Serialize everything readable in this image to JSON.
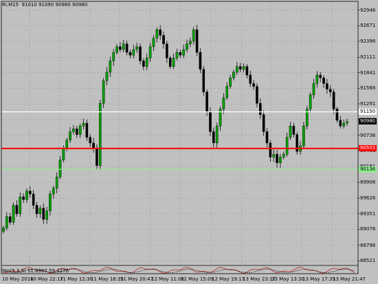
{
  "header": {
    "symbol_line": "RI,M15  91010 91090 90980 90980"
  },
  "price_axis": {
    "labels": [
      "92946",
      "92671",
      "92396",
      "92111",
      "91841",
      "91566",
      "91291",
      "91016",
      "90736",
      "90461",
      "90181",
      "89906",
      "89626",
      "89351",
      "89076",
      "88796",
      "88521"
    ]
  },
  "horizontal_lines": [
    {
      "name": "white-level",
      "label": "91150",
      "price": 91150,
      "color": "#ffffff",
      "text_color": "#000000"
    },
    {
      "name": "red-level",
      "label": "90503",
      "price": 90503,
      "color": "#ff0000",
      "text_color": "#ffffff"
    },
    {
      "name": "green-level",
      "label": "90136",
      "price": 90136,
      "color": "#90ee90",
      "text_color": "#000000"
    }
  ],
  "current_price": {
    "label": "90980",
    "price": 90980
  },
  "indicator": {
    "label": "Sto(5,3,3) 51.8987 59.4276"
  },
  "time_axis": {
    "labels": [
      "10 May 2016",
      "10 May 22:17",
      "11 May 12:30",
      "11 May 16:35",
      "11 May 20:47",
      "12 May 11:00",
      "12 May 15:09",
      "12 May 19:17",
      "13 May 23:17",
      "13 May 13:30",
      "13 May 17:35",
      "13 May 21:47"
    ]
  },
  "chart_data": {
    "type": "candlestick",
    "symbol": "RI",
    "timeframe": "M15",
    "ylim": [
      88450,
      93100
    ],
    "closes": [
      89100,
      89300,
      89200,
      89500,
      89350,
      89650,
      89600,
      89750,
      89700,
      89500,
      89350,
      89450,
      89250,
      89400,
      89700,
      89800,
      90000,
      90300,
      90500,
      90650,
      90800,
      90850,
      90750,
      90900,
      90950,
      90700,
      90600,
      90500,
      90200,
      91300,
      91700,
      91850,
      92050,
      92200,
      92300,
      92250,
      92350,
      92200,
      92150,
      92250,
      92300,
      92050,
      91950,
      92100,
      92300,
      92450,
      92600,
      92500,
      92350,
      92100,
      91950,
      92100,
      92200,
      92150,
      92250,
      92350,
      92400,
      92600,
      92200,
      91900,
      91500,
      91150,
      90800,
      90600,
      90900,
      91200,
      91400,
      91600,
      91750,
      91850,
      91950,
      91900,
      91950,
      91800,
      91650,
      91600,
      91300,
      91100,
      90800,
      90600,
      90350,
      90400,
      90250,
      90350,
      90400,
      90700,
      90900,
      90750,
      90450,
      90550,
      90900,
      91200,
      91450,
      91650,
      91800,
      91750,
      91650,
      91550,
      91500,
      91200,
      91000,
      90900,
      90950,
      90980
    ],
    "stochastic": {
      "k": 51.8987,
      "d": 59.4276
    }
  }
}
